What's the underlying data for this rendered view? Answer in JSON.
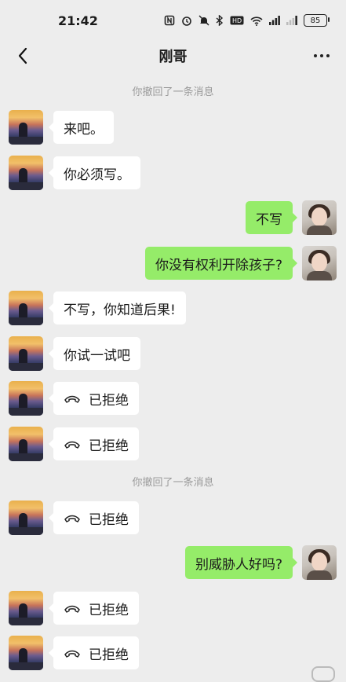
{
  "status_bar": {
    "time": "21:42",
    "icons": [
      "nfc-icon",
      "alarm-icon",
      "mute-icon",
      "bluetooth-icon",
      "hd-icon",
      "wifi-icon",
      "signal-icon",
      "signal-icon"
    ],
    "battery": "85"
  },
  "header": {
    "title": "刚哥"
  },
  "system": {
    "recall_1": "你撤回了一条消息",
    "recall_2": "你撤回了一条消息"
  },
  "messages": [
    {
      "side": "left",
      "text": "来吧。"
    },
    {
      "side": "left",
      "text": "你必须写。"
    },
    {
      "side": "right",
      "text": "不写"
    },
    {
      "side": "right",
      "text": "你没有权利开除孩子?"
    },
    {
      "side": "left",
      "text": "不写，你知道后果!"
    },
    {
      "side": "left",
      "text": "你试一试吧"
    },
    {
      "side": "left",
      "text": "已拒绝",
      "type": "call"
    },
    {
      "side": "left",
      "text": "已拒绝",
      "type": "call"
    },
    {
      "side": "left",
      "text": "已拒绝",
      "type": "call"
    },
    {
      "side": "right",
      "text": "别威胁人好吗?"
    },
    {
      "side": "left",
      "text": "已拒绝",
      "type": "call"
    },
    {
      "side": "left",
      "text": "已拒绝",
      "type": "call"
    }
  ],
  "colors": {
    "background": "#ededed",
    "sent_bubble": "#95ec69",
    "received_bubble": "#ffffff",
    "system_text": "#9a9a9a"
  }
}
